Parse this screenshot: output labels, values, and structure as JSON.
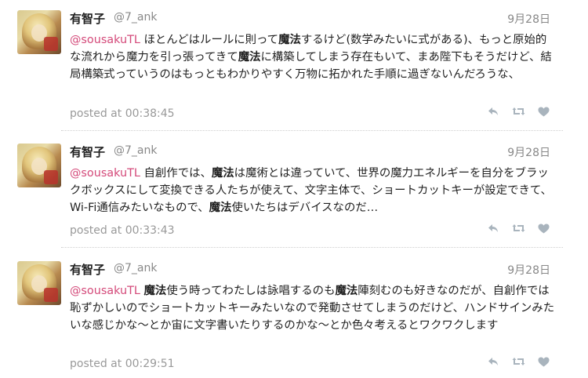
{
  "tweets": [
    {
      "name": "有智子",
      "handle": "@7_ank",
      "date": "9月28日",
      "mention": "@sousakuTL",
      "body_segments": [
        {
          "t": " ほとんどはルールに則って"
        },
        {
          "t": "魔法",
          "b": true
        },
        {
          "t": "するけど(数学みたいに式がある)、もっと原始的な流れから魔力を引っ張ってきて"
        },
        {
          "t": "魔法",
          "b": true
        },
        {
          "t": "に構築してしまう存在もいて、まあ陛下もそうだけど、結局構築式っていうのはもっともわかりやすく万物に拓かれた手順に過ぎないんだろうな、"
        }
      ],
      "posted": "posted at 00:38:45"
    },
    {
      "name": "有智子",
      "handle": "@7_ank",
      "date": "9月28日",
      "mention": "@sousakuTL",
      "body_segments": [
        {
          "t": " 自創作では、"
        },
        {
          "t": "魔法",
          "b": true
        },
        {
          "t": "は魔術とは違っていて、世界の魔力エネルギーを自分をブラックボックスにして変換できる人たちが使えて、文字主体で、ショートカットキーが設定できて、Wi-Fi通信みたいなもので、"
        },
        {
          "t": "魔法",
          "b": true
        },
        {
          "t": "使いたちはデバイスなのだ…"
        }
      ],
      "posted": "posted at 00:33:43"
    },
    {
      "name": "有智子",
      "handle": "@7_ank",
      "date": "9月28日",
      "mention": "@sousakuTL",
      "body_segments": [
        {
          "t": " "
        },
        {
          "t": "魔法",
          "b": true
        },
        {
          "t": "使う時ってわたしは詠唱するのも"
        },
        {
          "t": "魔法",
          "b": true
        },
        {
          "t": "陣刻むのも好きなのだが、自創作では恥ずかしいのでショートカットキーみたいなので発動させてしまうのだけど、ハンドサインみたいな感じかな〜とか宙に文字書いたりするのかな〜とか色々考えるとワクワクします"
        }
      ],
      "posted": "posted at 00:29:51"
    }
  ],
  "icons": {
    "reply": "reply-icon",
    "retweet": "retweet-icon",
    "favorite": "heart-icon"
  },
  "colors": {
    "mention": "#d44a7a",
    "meta": "#999999",
    "icon": "#a9b4bd"
  }
}
